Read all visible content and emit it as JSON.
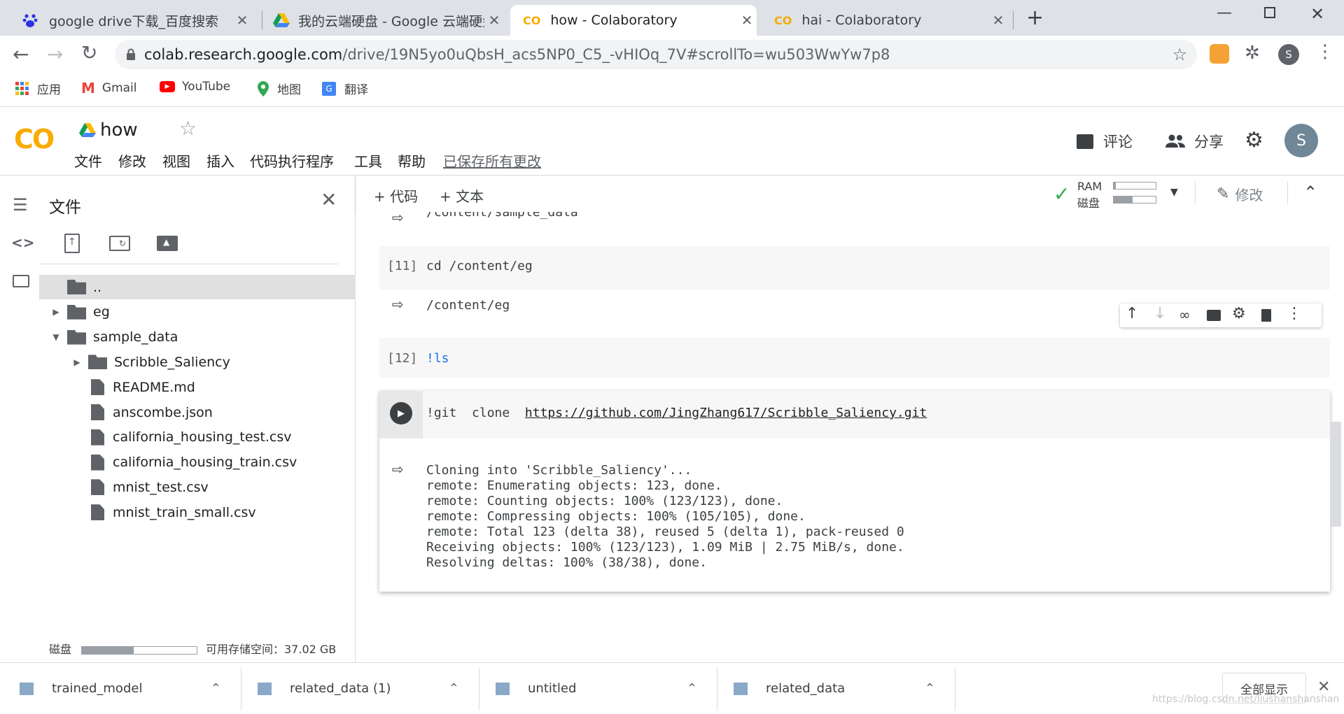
{
  "browser": {
    "tabs": [
      {
        "title": "google drive下载_百度搜索",
        "icon": "baidu-paw-icon"
      },
      {
        "title": "我的云端硬盘 - Google 云端硬盘",
        "icon": "google-drive-icon"
      },
      {
        "title": "how - Colaboratory",
        "icon": "colab-icon"
      },
      {
        "title": "hai - Colaboratory",
        "icon": "colab-icon"
      }
    ],
    "url_host": "colab.research.google.com",
    "url_path": "/drive/19N5yo0uQbsH_acs5NP0_C5_-vHIOq_7V#scrollTo=wu503WwYw7p8",
    "profile_letter": "S",
    "bookmarks": [
      {
        "label": "应用",
        "icon": "apps-grid-icon"
      },
      {
        "label": "Gmail",
        "icon": "gmail-icon"
      },
      {
        "label": "YouTube",
        "icon": "youtube-icon"
      },
      {
        "label": "地图",
        "icon": "maps-pin-icon"
      },
      {
        "label": "翻译",
        "icon": "translate-icon"
      }
    ]
  },
  "colab": {
    "logo_text": "CO",
    "notebook_title": "how",
    "menu": [
      "文件",
      "修改",
      "视图",
      "插入",
      "代码执行程序",
      "工具",
      "帮助"
    ],
    "saved_status": "已保存所有更改",
    "comment_label": "评论",
    "share_label": "分享",
    "avatar_letter": "S",
    "add_code_label": "+ 代码",
    "add_text_label": "+ 文本",
    "ram_label": "RAM",
    "disk_label": "磁盘",
    "ram_usage": 0.05,
    "disk_usage": 0.45,
    "edit_label": "修改"
  },
  "sidebar": {
    "title": "文件",
    "tree": [
      {
        "name": "..",
        "type": "up",
        "depth": 0,
        "selected": true
      },
      {
        "name": "eg",
        "type": "folder",
        "depth": 0,
        "expander": "collapsed"
      },
      {
        "name": "sample_data",
        "type": "folder",
        "depth": 0,
        "expander": "expanded"
      },
      {
        "name": "Scribble_Saliency",
        "type": "folder",
        "depth": 1,
        "expander": "collapsed"
      },
      {
        "name": "README.md",
        "type": "file",
        "depth": 1
      },
      {
        "name": "anscombe.json",
        "type": "file",
        "depth": 1
      },
      {
        "name": "california_housing_test.csv",
        "type": "file",
        "depth": 1
      },
      {
        "name": "california_housing_train.csv",
        "type": "file",
        "depth": 1
      },
      {
        "name": "mnist_test.csv",
        "type": "file",
        "depth": 1
      },
      {
        "name": "mnist_train_small.csv",
        "type": "file",
        "depth": 1
      }
    ],
    "disk_label": "磁盘",
    "disk_usage": 0.45,
    "storage_text": "可用存储空间：37.02 GB"
  },
  "notebook": {
    "partial_output": "/content/sample_data",
    "cell11": {
      "prompt": "[11]",
      "code": "cd  /content/eg",
      "output": "/content/eg"
    },
    "cell12": {
      "prompt": "[12]",
      "code": "!ls"
    },
    "cell13": {
      "code_prefix": "!git  clone  ",
      "code_url": "https://github.com/JingZhang617/Scribble_Saliency.git",
      "output_lines": [
        "Cloning into 'Scribble_Saliency'...",
        "remote: Enumerating objects: 123, done.",
        "remote: Counting objects: 100% (123/123), done.",
        "remote: Compressing objects: 100% (105/105), done.",
        "remote: Total 123 (delta 38), reused 5 (delta 1), pack-reused 0",
        "Receiving objects: 100% (123/123), 1.09 MiB | 2.75 MiB/s, done.",
        "Resolving deltas: 100% (38/38), done."
      ]
    }
  },
  "downloads": {
    "items": [
      "trained_model",
      "related_data (1)",
      "untitled",
      "related_data"
    ],
    "show_all_label": "全部显示"
  },
  "watermark": "https://blog.csdn.net/liushanshanshan"
}
